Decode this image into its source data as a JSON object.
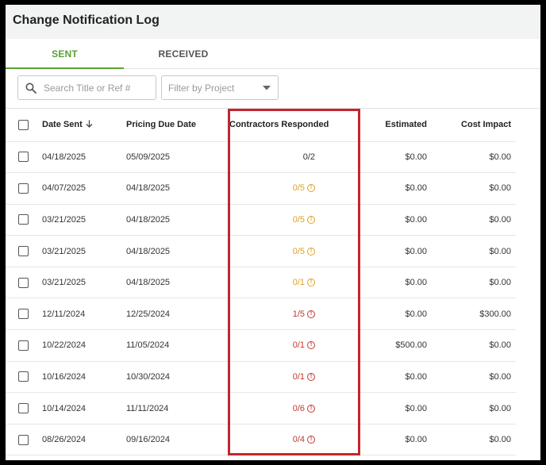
{
  "page": {
    "title": "Change Notification Log"
  },
  "tabs": [
    {
      "label": "SENT",
      "active": true
    },
    {
      "label": "RECEIVED",
      "active": false
    }
  ],
  "filters": {
    "search_placeholder": "Search Title or Ref #",
    "project_placeholder": "Filter by Project"
  },
  "table": {
    "columns": {
      "date_sent": "Date Sent",
      "pricing_due": "Pricing Due Date",
      "responded": "Contractors Responded",
      "estimated": "Estimated",
      "cost_impact": "Cost Impact"
    },
    "rows": [
      {
        "date_sent": "04/18/2025",
        "pricing_due": "05/09/2025",
        "responded": "0/2",
        "status": "none",
        "estimated": "$0.00",
        "cost_impact": "$0.00"
      },
      {
        "date_sent": "04/07/2025",
        "pricing_due": "04/18/2025",
        "responded": "0/5",
        "status": "warning",
        "estimated": "$0.00",
        "cost_impact": "$0.00"
      },
      {
        "date_sent": "03/21/2025",
        "pricing_due": "04/18/2025",
        "responded": "0/5",
        "status": "warning",
        "estimated": "$0.00",
        "cost_impact": "$0.00"
      },
      {
        "date_sent": "03/21/2025",
        "pricing_due": "04/18/2025",
        "responded": "0/5",
        "status": "warning",
        "estimated": "$0.00",
        "cost_impact": "$0.00"
      },
      {
        "date_sent": "03/21/2025",
        "pricing_due": "04/18/2025",
        "responded": "0/1",
        "status": "warning",
        "estimated": "$0.00",
        "cost_impact": "$0.00"
      },
      {
        "date_sent": "12/11/2024",
        "pricing_due": "12/25/2024",
        "responded": "1/5",
        "status": "overdue",
        "estimated": "$0.00",
        "cost_impact": "$300.00"
      },
      {
        "date_sent": "10/22/2024",
        "pricing_due": "11/05/2024",
        "responded": "0/1",
        "status": "overdue",
        "estimated": "$500.00",
        "cost_impact": "$0.00"
      },
      {
        "date_sent": "10/16/2024",
        "pricing_due": "10/30/2024",
        "responded": "0/1",
        "status": "overdue",
        "estimated": "$0.00",
        "cost_impact": "$0.00"
      },
      {
        "date_sent": "10/14/2024",
        "pricing_due": "11/11/2024",
        "responded": "0/6",
        "status": "overdue",
        "estimated": "$0.00",
        "cost_impact": "$0.00"
      },
      {
        "date_sent": "08/26/2024",
        "pricing_due": "09/16/2024",
        "responded": "0/4",
        "status": "overdue",
        "estimated": "$0.00",
        "cost_impact": "$0.00"
      }
    ]
  },
  "colors": {
    "accent_green": "#5aa136",
    "warning_amber": "#e0a024",
    "overdue_red": "#c0392b",
    "default_text": "#333333",
    "highlight_red": "#c0272d"
  },
  "icons": {
    "search": "search-icon",
    "sort": "arrow-down-icon",
    "dropdown": "chevron-down-icon",
    "status": "alert-circle-icon"
  }
}
